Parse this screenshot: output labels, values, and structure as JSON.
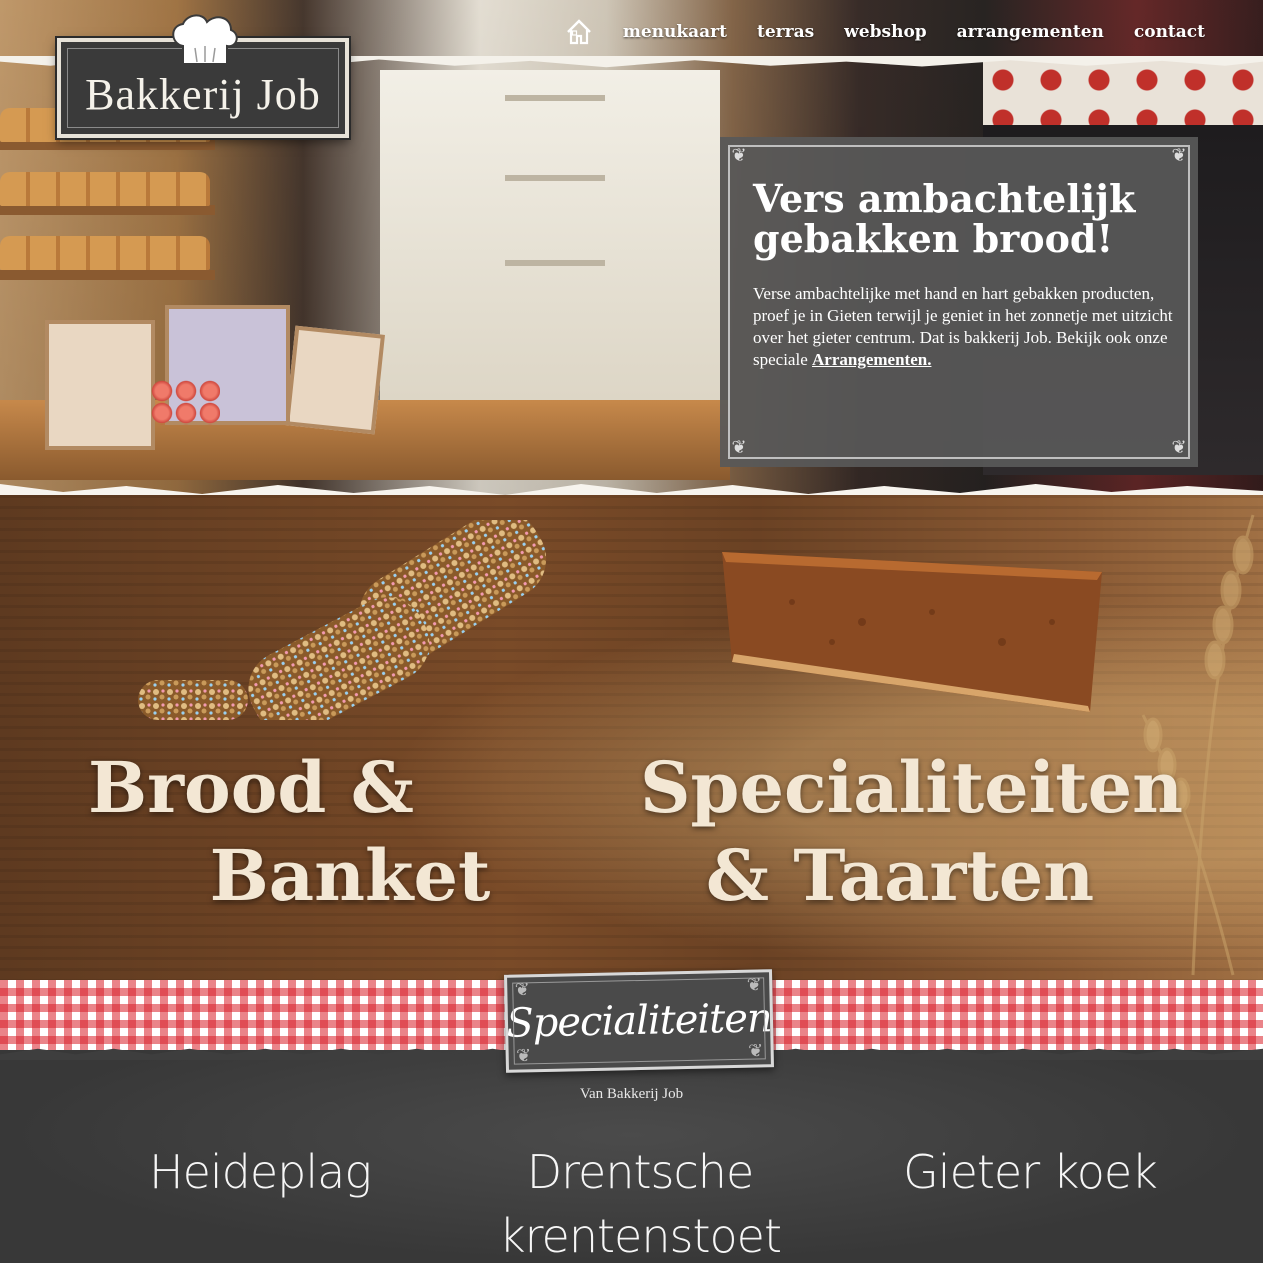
{
  "brand": {
    "name": "Bakkerij Job"
  },
  "nav": {
    "home_icon": "home-icon",
    "items": [
      {
        "label": "menukaart"
      },
      {
        "label": "terras"
      },
      {
        "label": "webshop"
      },
      {
        "label": "arrangementen"
      },
      {
        "label": "contact"
      }
    ]
  },
  "hero": {
    "title": "Vers ambachtelijk gebakken brood!",
    "text": "Verse ambachtelijke met hand en hart gebakken producten, proef je in Gieten terwijl je geniet in het zonnetje met uitzicht over het gieter centrum. Dat is bakkerij Job. Bekijk ook onze speciale",
    "link": "Arrangementen."
  },
  "categories": [
    {
      "line1": "Brood &",
      "line2": "Banket"
    },
    {
      "line1": "Specialiteiten",
      "line2": "& Taarten"
    }
  ],
  "specialties": {
    "heading": "Specialiteiten",
    "subtitle": "Van Bakkerij Job",
    "items": [
      {
        "line1": "Heideplag",
        "line2": ""
      },
      {
        "line1": "Drentsche",
        "line2": "krentenstoet"
      },
      {
        "line1": "Gieter koek",
        "line2": ""
      }
    ]
  },
  "colors": {
    "panel": "#585858",
    "heading_cream": "#f3e7d4",
    "gingham_red": "#d81e28",
    "chalkboard": "#3e3e3e"
  }
}
